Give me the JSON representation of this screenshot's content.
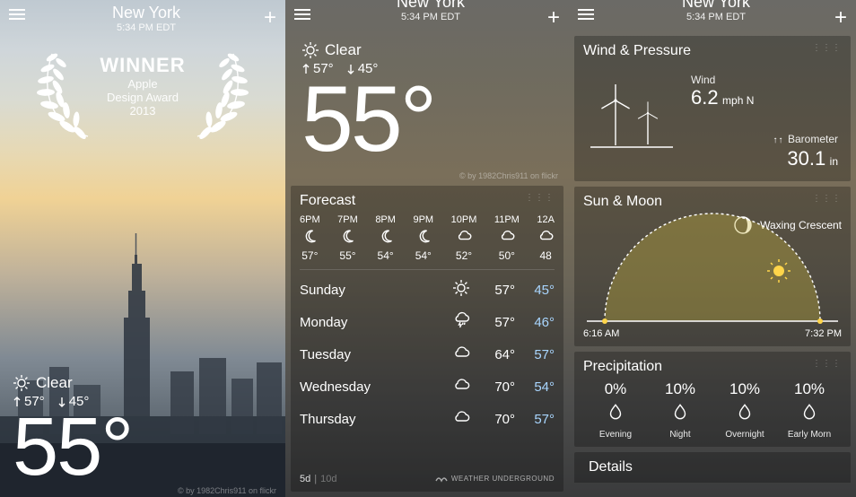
{
  "location": {
    "name": "New York",
    "time": "5:34 PM EDT"
  },
  "award": {
    "title": "WINNER",
    "line1": "Apple",
    "line2": "Design Award",
    "line3": "2013"
  },
  "current": {
    "condition": "Clear",
    "high": "57°",
    "low": "45°",
    "temp": "55°"
  },
  "attribution": "© by 1982Chris911 on flickr",
  "forecast": {
    "title": "Forecast",
    "hourly": [
      {
        "time": "6PM",
        "icon": "moon",
        "temp": "57°"
      },
      {
        "time": "7PM",
        "icon": "moon",
        "temp": "55°"
      },
      {
        "time": "8PM",
        "icon": "moon",
        "temp": "54°"
      },
      {
        "time": "9PM",
        "icon": "moon",
        "temp": "54°"
      },
      {
        "time": "10PM",
        "icon": "cloud",
        "temp": "52°"
      },
      {
        "time": "11PM",
        "icon": "cloud",
        "temp": "50°"
      },
      {
        "time": "12A",
        "icon": "cloud",
        "temp": "48"
      }
    ],
    "daily": [
      {
        "day": "Sunday",
        "icon": "sun",
        "hi": "57°",
        "lo": "45°"
      },
      {
        "day": "Monday",
        "icon": "storm",
        "hi": "57°",
        "lo": "46°"
      },
      {
        "day": "Tuesday",
        "icon": "cloud",
        "hi": "64°",
        "lo": "57°"
      },
      {
        "day": "Wednesday",
        "icon": "cloud",
        "hi": "70°",
        "lo": "54°"
      },
      {
        "day": "Thursday",
        "icon": "cloud",
        "hi": "70°",
        "lo": "57°"
      }
    ],
    "toggle": {
      "active": "5d",
      "inactive": "10d"
    },
    "source": "WEATHER UNDERGROUND"
  },
  "wind": {
    "title": "Wind & Pressure",
    "wind_label": "Wind",
    "speed": "6.2",
    "unit": "mph N",
    "baro_label": "Barometer",
    "baro_val": "30.1",
    "baro_unit": "in",
    "baro_arrows": "↑↑"
  },
  "sunmoon": {
    "title": "Sun & Moon",
    "moon_phase": "Waxing Crescent",
    "sunrise": "6:16 AM",
    "sunset": "7:32 PM"
  },
  "precip": {
    "title": "Precipitation",
    "items": [
      {
        "pct": "0%",
        "label": "Evening"
      },
      {
        "pct": "10%",
        "label": "Night"
      },
      {
        "pct": "10%",
        "label": "Overnight"
      },
      {
        "pct": "10%",
        "label": "Early Morn"
      }
    ]
  },
  "details_title": "Details"
}
